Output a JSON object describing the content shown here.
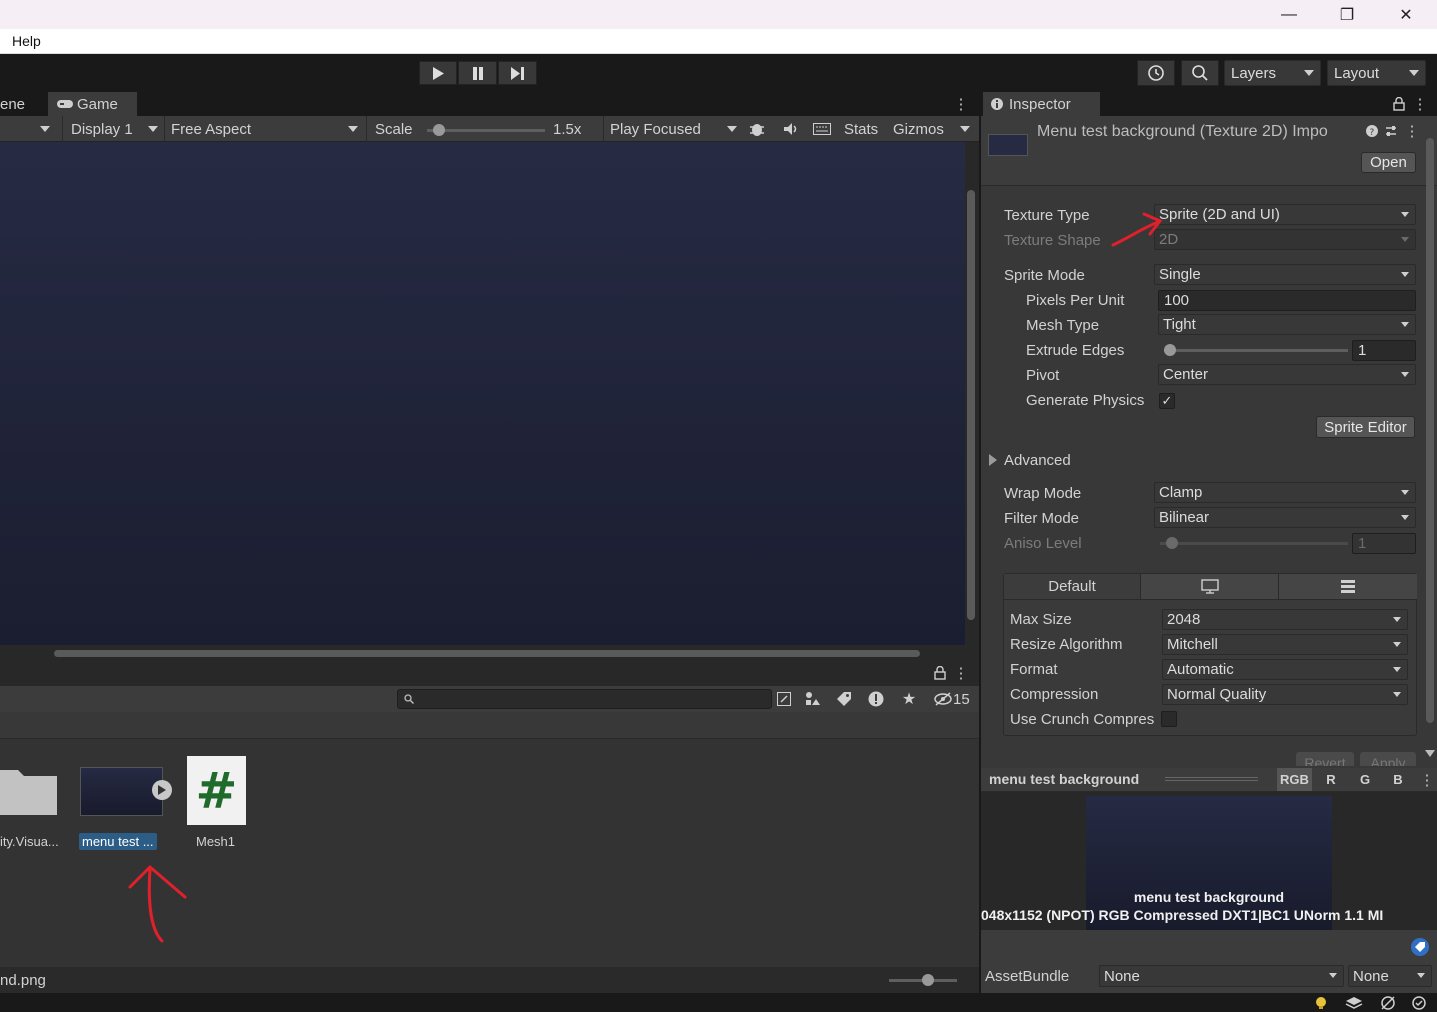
{
  "window": {
    "minimize": "—",
    "maximize": "❐",
    "close": "✕"
  },
  "menu": {
    "help": "Help"
  },
  "toolbar": {
    "layers": "Layers",
    "layout": "Layout"
  },
  "game": {
    "tab_scene": "ene",
    "tab_game": "Game",
    "display": "Display 1",
    "aspect": "Free Aspect",
    "scale_label": "Scale",
    "scale_value": "1.5x",
    "scale_level": 0.1,
    "play_mode": "Play Focused",
    "stats": "Stats",
    "gizmos": "Gizmos"
  },
  "project": {
    "hidden_count": "15",
    "items": [
      {
        "label": "ity.Visua..."
      },
      {
        "label": "menu test ..."
      },
      {
        "label": "Mesh1"
      }
    ],
    "footer_path": "nd.png"
  },
  "inspector": {
    "tab": "Inspector",
    "title": "Menu test background (Texture 2D) Impo",
    "open": "Open",
    "texture_type_label": "Texture Type",
    "texture_type": "Sprite (2D and UI)",
    "texture_shape_label": "Texture Shape",
    "texture_shape": "2D",
    "sprite_mode_label": "Sprite Mode",
    "sprite_mode": "Single",
    "ppu_label": "Pixels Per Unit",
    "ppu": "100",
    "mesh_type_label": "Mesh Type",
    "mesh_type": "Tight",
    "extrude_label": "Extrude Edges",
    "extrude": "1",
    "pivot_label": "Pivot",
    "pivot": "Center",
    "gen_physics_label": "Generate Physics",
    "gen_physics_check": "✓",
    "sprite_editor": "Sprite Editor",
    "advanced": "Advanced",
    "wrap_label": "Wrap Mode",
    "wrap": "Clamp",
    "filter_label": "Filter Mode",
    "filter": "Bilinear",
    "aniso_label": "Aniso Level",
    "aniso": "1",
    "platform_default": "Default",
    "max_size_label": "Max Size",
    "max_size": "2048",
    "resize_label": "Resize Algorithm",
    "resize": "Mitchell",
    "format_label": "Format",
    "format": "Automatic",
    "compression_label": "Compression",
    "compression": "Normal Quality",
    "crunch_label": "Use Crunch Compres",
    "revert": "Revert",
    "apply": "Apply"
  },
  "preview": {
    "name": "menu test background",
    "channels": [
      "RGB",
      "R",
      "G",
      "B"
    ],
    "overlay_name": "menu test background",
    "info": "048x1152 (NPOT)  RGB Compressed DXT1|BC1 UNorm   1.1 MI"
  },
  "assetbundle": {
    "label": "AssetBundle",
    "name": "None",
    "variant": "None"
  }
}
